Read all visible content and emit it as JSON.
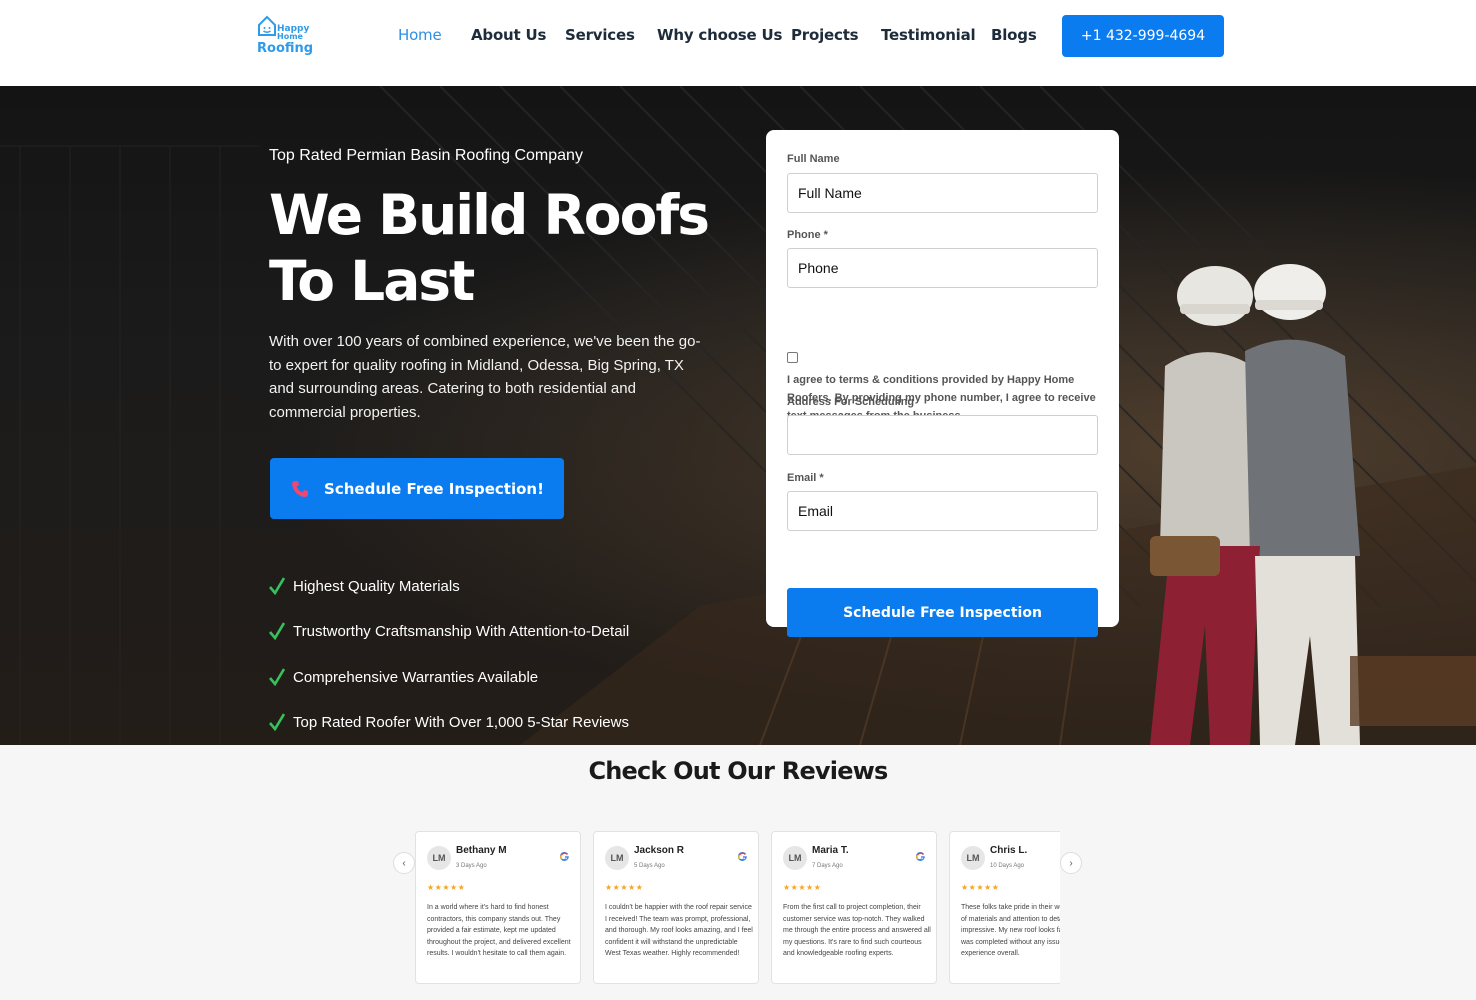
{
  "header": {
    "logo": {
      "line1": "Happy",
      "line2": "Home",
      "line3": "Roofing"
    },
    "nav": [
      {
        "label": "Home",
        "active": true
      },
      {
        "label": "About Us"
      },
      {
        "label": "Services"
      },
      {
        "label": "Why choose Us"
      },
      {
        "label": "Projects"
      },
      {
        "label": "Testimonial"
      },
      {
        "label": "Blogs"
      }
    ],
    "phone_button": "+1 432-999-4694"
  },
  "hero": {
    "eyebrow": "Top Rated Permian Basin Roofing Company",
    "headline_line1": "We Build Roofs",
    "headline_line2": "To Last",
    "description": "With over 100 years of combined experience, we've been the go-to expert for quality roofing in Midland, Odessa, Big Spring, TX and surrounding areas. Catering to both residential and commercial properties.",
    "cta": "Schedule Free Inspection!",
    "features": [
      "Highest Quality Materials",
      "Trustworthy Craftsmanship With Attention-to-Detail",
      "Comprehensive Warranties Available",
      "Top Rated Roofer With Over 1,000 5-Star Reviews"
    ]
  },
  "form": {
    "full_name_label": "Full Name",
    "full_name_placeholder": "Full Name",
    "phone_label": "Phone *",
    "phone_placeholder": "Phone",
    "consent_text": "I agree to terms & conditions provided by Happy Home Roofers. By providing my phone number, I agree to receive text messages from the business.",
    "address_label": "Address For Scheduling",
    "address_placeholder": "",
    "email_label": "Email *",
    "email_placeholder": "Email",
    "submit": "Schedule Free Inspection"
  },
  "reviews": {
    "title": "Check Out Our Reviews",
    "prev": "‹",
    "next": "›",
    "items": [
      {
        "initials": "LM",
        "name": "Bethany M",
        "date": "3 Days Ago",
        "stars": "★★★★★",
        "text": "In a world where it's hard to find honest contractors, this company stands out. They provided a fair estimate, kept me updated throughout the project, and delivered excellent results. I wouldn't hesitate to call them again."
      },
      {
        "initials": "LM",
        "name": "Jackson R",
        "date": "5 Days Ago",
        "stars": "★★★★★",
        "text": "I couldn't be happier with the roof repair service I received! The team was prompt, professional, and thorough. My roof looks amazing, and I feel confident it will withstand the unpredictable West Texas weather. Highly recommended!"
      },
      {
        "initials": "LM",
        "name": "Maria T.",
        "date": "7 Days Ago",
        "stars": "★★★★★",
        "text": "From the first call to project completion, their customer service was top-notch. They walked me through the entire process and answered all my questions. It's rare to find such courteous and knowledgeable roofing experts."
      },
      {
        "initials": "LM",
        "name": "Chris L.",
        "date": "10 Days Ago",
        "stars": "★★★★★",
        "text": "These folks take pride in their work. The quality of materials and attention to detail were impressive. My new roof looks fantastic and was completed without any issues. Great experience overall."
      }
    ]
  },
  "colors": {
    "accent": "#0b7cf0",
    "nav_active": "#2d8fe6",
    "check": "#35c25b",
    "star": "#f5a623"
  }
}
